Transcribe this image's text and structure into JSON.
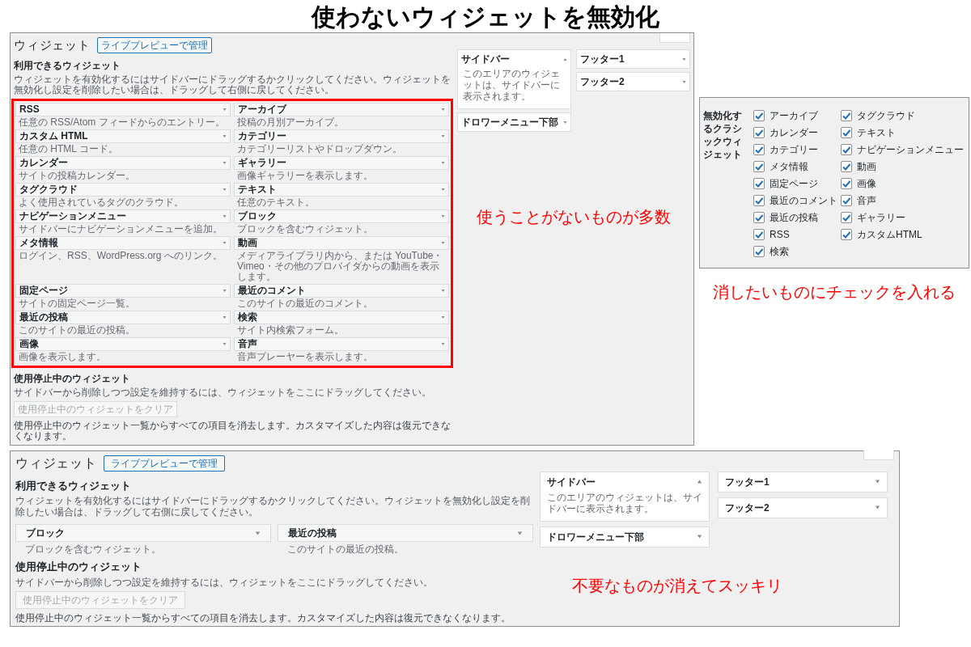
{
  "title": "使わないウィジェットを無効化",
  "before_screen": {
    "heading": "ウィジェット",
    "preview_button": "ライブプレビューで管理",
    "available": {
      "heading": "利用できるウィジェット",
      "description": "ウィジェットを有効化するにはサイドバーにドラッグするかクリックしてください。ウィジェットを無効化し設定を削除したい場合は、ドラッグして右側に戻してください。",
      "highlighted": true,
      "widgets": [
        {
          "name": "RSS",
          "description": "任意の RSS/Atom フィードからのエントリー。"
        },
        {
          "name": "アーカイブ",
          "description": "投稿の月別アーカイブ。"
        },
        {
          "name": "カスタム HTML",
          "description": "任意の HTML コード。"
        },
        {
          "name": "カテゴリー",
          "description": "カテゴリーリストやドロップダウン。"
        },
        {
          "name": "カレンダー",
          "description": "サイトの投稿カレンダー。"
        },
        {
          "name": "ギャラリー",
          "description": "画像ギャラリーを表示します。"
        },
        {
          "name": "タグクラウド",
          "description": "よく使用されているタグのクラウド。"
        },
        {
          "name": "テキスト",
          "description": "任意のテキスト。"
        },
        {
          "name": "ナビゲーションメニュー",
          "description": "サイドバーにナビゲーションメニューを追加。"
        },
        {
          "name": "ブロック",
          "description": "ブロックを含むウィジェット。"
        },
        {
          "name": "メタ情報",
          "description": "ログイン、RSS、WordPress.org へのリンク。"
        },
        {
          "name": "動画",
          "description": "メディアライブラリ内から、または YouTube・Vimeo・その他のプロバイダからの動画を表示します。"
        },
        {
          "name": "固定ページ",
          "description": "サイトの固定ページ一覧。"
        },
        {
          "name": "最近のコメント",
          "description": "このサイトの最近のコメント。"
        },
        {
          "name": "最近の投稿",
          "description": "このサイトの最近の投稿。"
        },
        {
          "name": "検索",
          "description": "サイト内検索フォーム。"
        },
        {
          "name": "画像",
          "description": "画像を表示します。"
        },
        {
          "name": "音声",
          "description": "音声プレーヤーを表示します。"
        }
      ]
    },
    "area_columns": [
      [
        {
          "name": "サイドバー",
          "expanded": true,
          "description": "このエリアのウィジェットは、サイドバーに表示されます。"
        },
        {
          "name": "ドロワーメニュー下部",
          "expanded": false
        }
      ],
      [
        {
          "name": "フッター1",
          "expanded": false
        },
        {
          "name": "フッター2",
          "expanded": false
        }
      ]
    ],
    "inactive": {
      "heading": "使用停止中のウィジェット",
      "description": "サイドバーから削除しつつ設定を維持するには、ウィジェットをここにドラッグしてください。",
      "clear_button": "使用停止中のウィジェットをクリア",
      "note": "使用停止中のウィジェット一覧からすべての項目を消去します。カスタマイズした内容は復元できなくなります。"
    }
  },
  "before_caption": "使うことがないものが多数",
  "settings": {
    "label": "無効化するクラシックウィジェット",
    "columns": [
      [
        {
          "label": "アーカイブ",
          "checked": true
        },
        {
          "label": "カレンダー",
          "checked": true
        },
        {
          "label": "カテゴリー",
          "checked": true
        },
        {
          "label": "メタ情報",
          "checked": true
        },
        {
          "label": "固定ページ",
          "checked": true
        },
        {
          "label": "最近のコメント",
          "checked": true
        },
        {
          "label": "最近の投稿",
          "checked": true
        },
        {
          "label": "RSS",
          "checked": true
        },
        {
          "label": "検索",
          "checked": true
        }
      ],
      [
        {
          "label": "タグクラウド",
          "checked": true
        },
        {
          "label": "テキスト",
          "checked": true
        },
        {
          "label": "ナビゲーションメニュー",
          "checked": true
        },
        {
          "label": "動画",
          "checked": true
        },
        {
          "label": "画像",
          "checked": true
        },
        {
          "label": "音声",
          "checked": true
        },
        {
          "label": "ギャラリー",
          "checked": true
        },
        {
          "label": "カスタムHTML",
          "checked": true
        }
      ]
    ]
  },
  "settings_caption": "消したいものにチェックを入れる",
  "after_screen": {
    "heading": "ウィジェット",
    "preview_button": "ライブプレビューで管理",
    "available": {
      "heading": "利用できるウィジェット",
      "description": "ウィジェットを有効化するにはサイドバーにドラッグするかクリックしてください。ウィジェットを無効化し設定を削除したい場合は、ドラッグして右側に戻してください。",
      "highlighted": false,
      "widgets": [
        {
          "name": "ブロック",
          "description": "ブロックを含むウィジェット。"
        },
        {
          "name": "最近の投稿",
          "description": "このサイトの最近の投稿。"
        }
      ]
    },
    "area_columns": [
      [
        {
          "name": "サイドバー",
          "expanded": true,
          "description": "このエリアのウィジェットは、サイドバーに表示されます。"
        },
        {
          "name": "ドロワーメニュー下部",
          "expanded": false
        }
      ],
      [
        {
          "name": "フッター1",
          "expanded": false
        },
        {
          "name": "フッター2",
          "expanded": false
        }
      ]
    ],
    "inactive": {
      "heading": "使用停止中のウィジェット",
      "description": "サイドバーから削除しつつ設定を維持するには、ウィジェットをここにドラッグしてください。",
      "clear_button": "使用停止中のウィジェットをクリア",
      "note": "使用停止中のウィジェット一覧からすべての項目を消去します。カスタマイズした内容は復元できなくなります。"
    }
  },
  "after_caption": "不要なものが消えてスッキリ"
}
